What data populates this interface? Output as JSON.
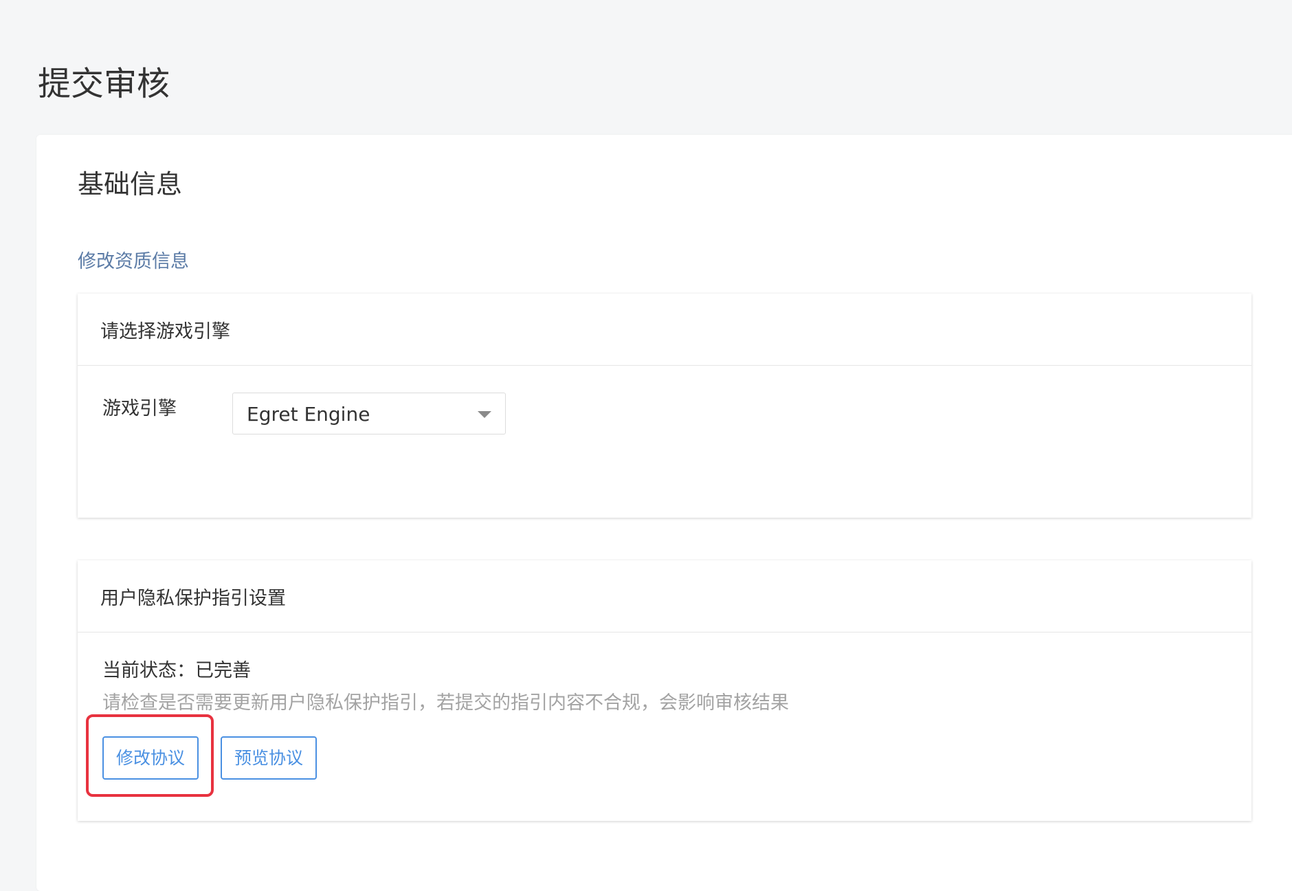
{
  "page": {
    "title": "提交审核"
  },
  "basic_info": {
    "title": "基础信息",
    "edit_qualification_link": "修改资质信息"
  },
  "engine_panel": {
    "header": "请选择游戏引擎",
    "field_label": "游戏引擎",
    "selected_value": "Egret Engine"
  },
  "privacy_panel": {
    "header": "用户隐私保护指引设置",
    "status_text": "当前状态：已完善",
    "hint_text": "请检查是否需要更新用户隐私保护指引，若提交的指引内容不合规，会影响审核结果",
    "edit_button": "修改协议",
    "preview_button": "预览协议"
  },
  "colors": {
    "accent": "#4a90e2",
    "link": "#5b7ba6",
    "highlight": "#e8323f"
  }
}
